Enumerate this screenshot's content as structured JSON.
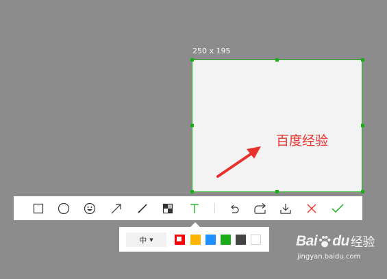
{
  "capture": {
    "size_label": "250 x 195",
    "annotation_text": "百度经验",
    "annotation_color": "#e8322d",
    "border_color": "#1aad19"
  },
  "toolbar": {
    "tools": [
      {
        "name": "rectangle-tool",
        "icon": "rectangle-icon"
      },
      {
        "name": "ellipse-tool",
        "icon": "circle-icon"
      },
      {
        "name": "emoji-tool",
        "icon": "smiley-icon"
      },
      {
        "name": "arrow-tool",
        "icon": "arrow-icon"
      },
      {
        "name": "pen-tool",
        "icon": "brush-icon"
      },
      {
        "name": "mosaic-tool",
        "icon": "mosaic-icon"
      },
      {
        "name": "text-tool",
        "icon": "text-icon",
        "active": true
      },
      {
        "name": "undo-tool",
        "icon": "undo-icon"
      },
      {
        "name": "share-tool",
        "icon": "share-icon"
      },
      {
        "name": "save-tool",
        "icon": "download-icon"
      },
      {
        "name": "cancel-tool",
        "icon": "close-icon"
      },
      {
        "name": "confirm-tool",
        "icon": "check-icon"
      }
    ]
  },
  "subbar": {
    "font_size_value": "中",
    "colors": [
      "#ff0000",
      "#ffb400",
      "#1e90ff",
      "#1aad19",
      "#444444",
      "#ffffff"
    ],
    "selected_color": "#ff0000"
  },
  "watermark": {
    "brand": "Bai",
    "brand2": "du",
    "product": "经验",
    "url": "jingyan.baidu.com"
  }
}
